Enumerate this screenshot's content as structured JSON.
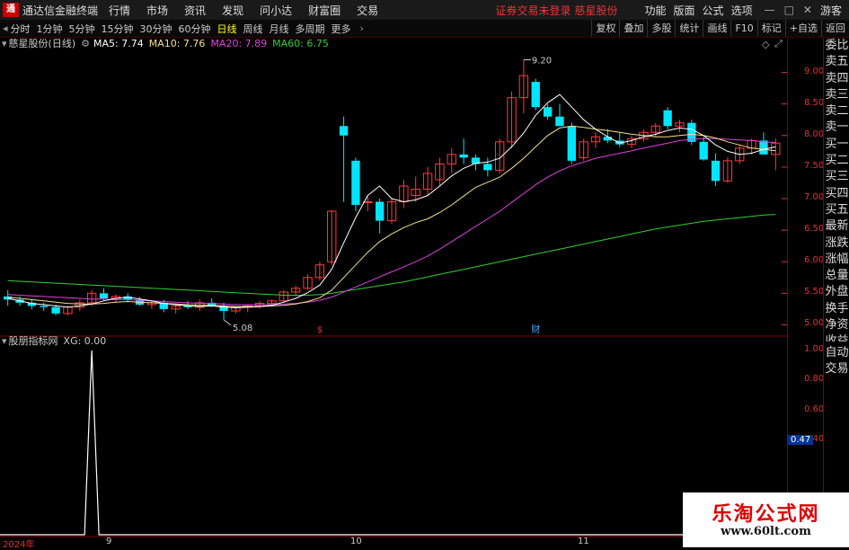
{
  "titlebar": {
    "logo": "通",
    "app_name": "通达信金融终端",
    "menu": [
      "行情",
      "市场",
      "资讯",
      "发现",
      "问小达",
      "财富圈",
      "交易"
    ],
    "warning": "证券交易未登录",
    "stock": "慈星股份",
    "right": [
      "功能",
      "版面",
      "公式",
      "选项"
    ],
    "guest": "游客"
  },
  "toolbar": {
    "periods": [
      "分时",
      "1分钟",
      "5分钟",
      "15分钟",
      "30分钟",
      "60分钟",
      "日线",
      "周线",
      "月线",
      "多周期",
      "更多"
    ],
    "active_period": "日线",
    "right_tools": [
      "复权",
      "叠加",
      "多股",
      "统计",
      "画线",
      "F10",
      "标记",
      "+自选",
      "返回"
    ]
  },
  "info": {
    "stock_period": "慈星股份(日线)",
    "ma5": "MA5: 7.74",
    "ma10": "MA10: 7.76",
    "ma20": "MA20: 7.89",
    "ma60": "MA60: 6.75"
  },
  "indicator": {
    "name": "股朋指标网",
    "value": "XG: 0.00",
    "current": "0.47"
  },
  "side_panel": [
    "委比",
    "卖五",
    "卖四",
    "卖三",
    "卖二",
    "卖一",
    "买一",
    "买二",
    "买三",
    "买四",
    "买五",
    "最新",
    "涨跌",
    "涨幅",
    "总量",
    "外盘",
    "换手",
    "净资",
    "收益",
    "自动",
    "交易"
  ],
  "price_axis": [
    "9.00",
    "8.50",
    "8.00",
    "7.50",
    "7.00",
    "6.50",
    "6.00",
    "5.50",
    "5.00"
  ],
  "ind_axis": [
    "1.00",
    "0.80",
    "0.60",
    "0.40"
  ],
  "annotations": {
    "high": "9.20",
    "low": "5.08",
    "marker1": "$",
    "marker2": "财"
  },
  "dates": [
    "2024年",
    "9",
    "10",
    "11"
  ],
  "watermark": {
    "title": "乐淘公式网",
    "url": "www.60lt.com"
  },
  "colors": {
    "up": "#ff3b3b",
    "down": "#00e5ff",
    "ma5": "#ffffff",
    "ma10": "#f5e08a",
    "ma20": "#e040e0",
    "ma60": "#30d030"
  },
  "chart_data": {
    "type": "candlestick",
    "ylim": [
      4.85,
      9.35
    ],
    "candles": [
      [
        5.45,
        5.55,
        5.3,
        5.4
      ],
      [
        5.4,
        5.45,
        5.3,
        5.35
      ],
      [
        5.35,
        5.4,
        5.25,
        5.3
      ],
      [
        5.3,
        5.35,
        5.22,
        5.28
      ],
      [
        5.28,
        5.32,
        5.15,
        5.18
      ],
      [
        5.18,
        5.3,
        5.15,
        5.28
      ],
      [
        5.28,
        5.4,
        5.22,
        5.35
      ],
      [
        5.35,
        5.55,
        5.3,
        5.5
      ],
      [
        5.5,
        5.58,
        5.38,
        5.42
      ],
      [
        5.42,
        5.48,
        5.35,
        5.45
      ],
      [
        5.45,
        5.5,
        5.36,
        5.4
      ],
      [
        5.4,
        5.44,
        5.3,
        5.32
      ],
      [
        5.32,
        5.38,
        5.25,
        5.35
      ],
      [
        5.35,
        5.4,
        5.2,
        5.25
      ],
      [
        5.25,
        5.33,
        5.18,
        5.3
      ],
      [
        5.3,
        5.38,
        5.25,
        5.28
      ],
      [
        5.28,
        5.4,
        5.22,
        5.35
      ],
      [
        5.35,
        5.42,
        5.28,
        5.3
      ],
      [
        5.3,
        5.35,
        5.08,
        5.22
      ],
      [
        5.22,
        5.3,
        5.18,
        5.28
      ],
      [
        5.28,
        5.32,
        5.2,
        5.3
      ],
      [
        5.3,
        5.38,
        5.26,
        5.34
      ],
      [
        5.34,
        5.4,
        5.3,
        5.38
      ],
      [
        5.38,
        5.55,
        5.35,
        5.52
      ],
      [
        5.52,
        5.62,
        5.45,
        5.58
      ],
      [
        5.58,
        5.8,
        5.55,
        5.75
      ],
      [
        5.75,
        6.0,
        5.7,
        5.95
      ],
      [
        6.0,
        6.82,
        5.95,
        6.8
      ],
      [
        8.15,
        8.3,
        6.95,
        8.0
      ],
      [
        7.6,
        7.65,
        6.8,
        6.9
      ],
      [
        6.95,
        7.05,
        6.8,
        6.95
      ],
      [
        6.95,
        7.0,
        6.45,
        6.65
      ],
      [
        6.65,
        7.0,
        6.6,
        6.95
      ],
      [
        6.95,
        7.3,
        6.85,
        7.2
      ],
      [
        7.05,
        7.35,
        6.95,
        7.15
      ],
      [
        7.15,
        7.5,
        7.05,
        7.4
      ],
      [
        7.3,
        7.65,
        7.2,
        7.55
      ],
      [
        7.55,
        7.8,
        7.4,
        7.7
      ],
      [
        7.7,
        7.95,
        7.55,
        7.65
      ],
      [
        7.65,
        7.7,
        7.45,
        7.55
      ],
      [
        7.55,
        7.65,
        7.35,
        7.45
      ],
      [
        7.45,
        7.95,
        7.4,
        7.9
      ],
      [
        7.9,
        8.7,
        7.8,
        8.6
      ],
      [
        8.6,
        9.2,
        8.35,
        8.95
      ],
      [
        8.85,
        8.9,
        8.4,
        8.45
      ],
      [
        8.45,
        8.5,
        8.25,
        8.3
      ],
      [
        8.3,
        8.5,
        8.2,
        8.15
      ],
      [
        8.15,
        8.2,
        7.55,
        7.6
      ],
      [
        7.65,
        7.95,
        7.6,
        7.9
      ],
      [
        7.9,
        8.05,
        7.8,
        7.98
      ],
      [
        7.98,
        8.1,
        7.88,
        7.92
      ],
      [
        7.92,
        8.05,
        7.82,
        7.86
      ],
      [
        7.86,
        8.0,
        7.8,
        7.95
      ],
      [
        7.95,
        8.1,
        7.9,
        8.05
      ],
      [
        8.05,
        8.2,
        7.98,
        8.15
      ],
      [
        8.4,
        8.45,
        8.1,
        8.15
      ],
      [
        8.15,
        8.25,
        8.05,
        8.2
      ],
      [
        8.2,
        8.25,
        7.85,
        7.9
      ],
      [
        7.9,
        7.98,
        7.6,
        7.62
      ],
      [
        7.6,
        7.72,
        7.2,
        7.28
      ],
      [
        7.28,
        7.65,
        7.25,
        7.6
      ],
      [
        7.6,
        7.85,
        7.55,
        7.8
      ],
      [
        7.8,
        7.95,
        7.7,
        7.92
      ],
      [
        7.92,
        8.05,
        7.82,
        7.7
      ],
      [
        7.7,
        7.95,
        7.45,
        7.88
      ]
    ],
    "ma5": [
      5.42,
      5.38,
      5.34,
      5.32,
      5.3,
      5.28,
      5.3,
      5.33,
      5.38,
      5.42,
      5.44,
      5.41,
      5.38,
      5.34,
      5.32,
      5.3,
      5.29,
      5.3,
      5.28,
      5.27,
      5.28,
      5.29,
      5.31,
      5.36,
      5.42,
      5.51,
      5.63,
      5.88,
      6.3,
      6.7,
      7.05,
      7.2,
      7.0,
      6.95,
      6.98,
      7.05,
      7.2,
      7.36,
      7.48,
      7.56,
      7.58,
      7.64,
      7.82,
      8.04,
      8.32,
      8.52,
      8.65,
      8.45,
      8.25,
      8.1,
      7.98,
      7.88,
      7.92,
      7.98,
      8.02,
      8.08,
      8.12,
      8.1,
      8.0,
      7.85,
      7.75,
      7.7,
      7.72,
      7.78,
      7.82
    ],
    "ma10": [
      5.44,
      5.42,
      5.4,
      5.38,
      5.36,
      5.34,
      5.33,
      5.33,
      5.34,
      5.36,
      5.37,
      5.36,
      5.35,
      5.34,
      5.33,
      5.32,
      5.31,
      5.31,
      5.3,
      5.29,
      5.29,
      5.29,
      5.3,
      5.31,
      5.33,
      5.37,
      5.43,
      5.55,
      5.75,
      5.95,
      6.15,
      6.32,
      6.44,
      6.54,
      6.62,
      6.68,
      6.78,
      6.9,
      7.04,
      7.18,
      7.26,
      7.34,
      7.48,
      7.64,
      7.82,
      8.0,
      8.12,
      8.15,
      8.13,
      8.1,
      8.08,
      8.05,
      8.02,
      8.0,
      7.98,
      7.98,
      8.0,
      8.02,
      8.0,
      7.96,
      7.9,
      7.85,
      7.8,
      7.78,
      7.76
    ],
    "ma20": [
      5.48,
      5.47,
      5.46,
      5.45,
      5.44,
      5.43,
      5.42,
      5.41,
      5.41,
      5.4,
      5.4,
      5.39,
      5.38,
      5.37,
      5.36,
      5.35,
      5.34,
      5.34,
      5.33,
      5.32,
      5.32,
      5.32,
      5.32,
      5.33,
      5.34,
      5.36,
      5.39,
      5.44,
      5.52,
      5.6,
      5.68,
      5.76,
      5.84,
      5.92,
      6.0,
      6.09,
      6.2,
      6.32,
      6.44,
      6.56,
      6.68,
      6.8,
      6.94,
      7.08,
      7.22,
      7.34,
      7.44,
      7.52,
      7.58,
      7.64,
      7.68,
      7.72,
      7.76,
      7.8,
      7.84,
      7.88,
      7.92,
      7.94,
      7.95,
      7.95,
      7.94,
      7.93,
      7.92,
      7.9,
      7.89
    ],
    "ma60": [
      5.7,
      5.69,
      5.68,
      5.67,
      5.66,
      5.65,
      5.64,
      5.63,
      5.62,
      5.61,
      5.6,
      5.59,
      5.58,
      5.57,
      5.56,
      5.55,
      5.54,
      5.53,
      5.52,
      5.51,
      5.5,
      5.49,
      5.48,
      5.47,
      5.47,
      5.47,
      5.48,
      5.5,
      5.53,
      5.56,
      5.59,
      5.62,
      5.65,
      5.68,
      5.72,
      5.76,
      5.8,
      5.84,
      5.88,
      5.92,
      5.96,
      6.0,
      6.04,
      6.08,
      6.12,
      6.16,
      6.2,
      6.24,
      6.28,
      6.32,
      6.36,
      6.4,
      6.44,
      6.48,
      6.52,
      6.55,
      6.58,
      6.61,
      6.64,
      6.66,
      6.68,
      6.7,
      6.72,
      6.74,
      6.75
    ],
    "xg_spike_index": 7,
    "xg_values": [
      0,
      0,
      0,
      0,
      0,
      0,
      0,
      1,
      0,
      0
    ]
  }
}
